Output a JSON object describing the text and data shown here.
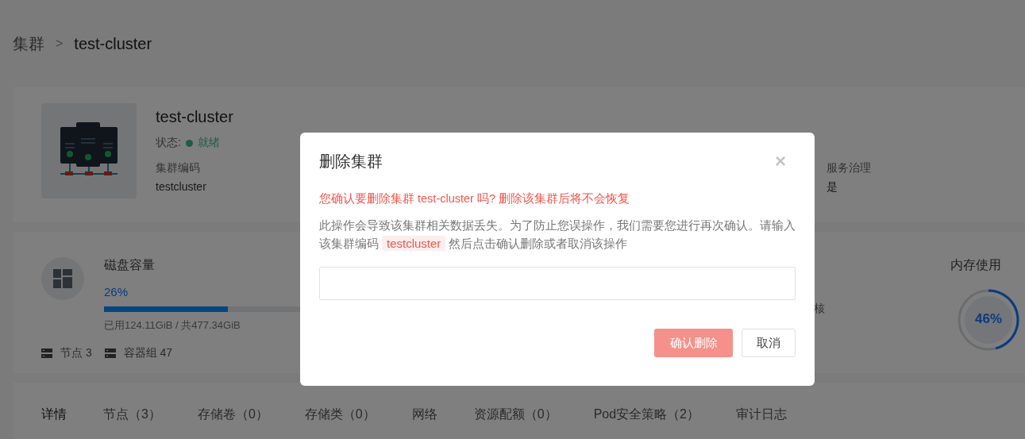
{
  "breadcrumb": {
    "items": [
      "集群",
      "test-cluster"
    ],
    "separator": ">"
  },
  "cluster": {
    "name": "test-cluster",
    "status_label": "状态:",
    "status": "就绪",
    "fields": [
      {
        "label": "集群编码",
        "value": "testcluster"
      },
      {
        "label": "服务治理",
        "value": "是"
      }
    ]
  },
  "resources": {
    "disk": {
      "title": "磁盘容量",
      "percent": "26%",
      "level": 0.26,
      "usage": "已用124.11GiB / 共477.34GiB"
    },
    "counts": [
      {
        "label": "节点",
        "value": "3"
      },
      {
        "label": "容器组",
        "value": "47"
      }
    ],
    "partial_text": "核",
    "memory": {
      "title": "内存使用",
      "percent": "46%",
      "level": 0.46
    }
  },
  "tabs": [
    {
      "label": "详情",
      "selected": true
    },
    {
      "label": "节点（3）",
      "selected": false
    },
    {
      "label": "存储卷（0）",
      "selected": false
    },
    {
      "label": "存储类（0）",
      "selected": false
    },
    {
      "label": "网络",
      "selected": false
    },
    {
      "label": "资源配额（0）",
      "selected": false
    },
    {
      "label": "Pod安全策略（2）",
      "selected": false
    },
    {
      "label": "审计日志",
      "selected": false
    }
  ],
  "dialog": {
    "title": "删除集群",
    "close": "×",
    "warning": "您确认要删除集群 test-cluster 吗? 删除该集群后将不会恢复",
    "description": {
      "before": "此操作会导致该集群相关数据丢失。为了防止您误操作，我们需要您进行再次确认。请输入该集群编码",
      "code": "testcluster",
      "after": "然后点击确认删除或者取消该操作"
    },
    "buttons": [
      {
        "label": "确认删除",
        "kind": "danger"
      },
      {
        "label": "取消",
        "kind": "default"
      }
    ]
  }
}
